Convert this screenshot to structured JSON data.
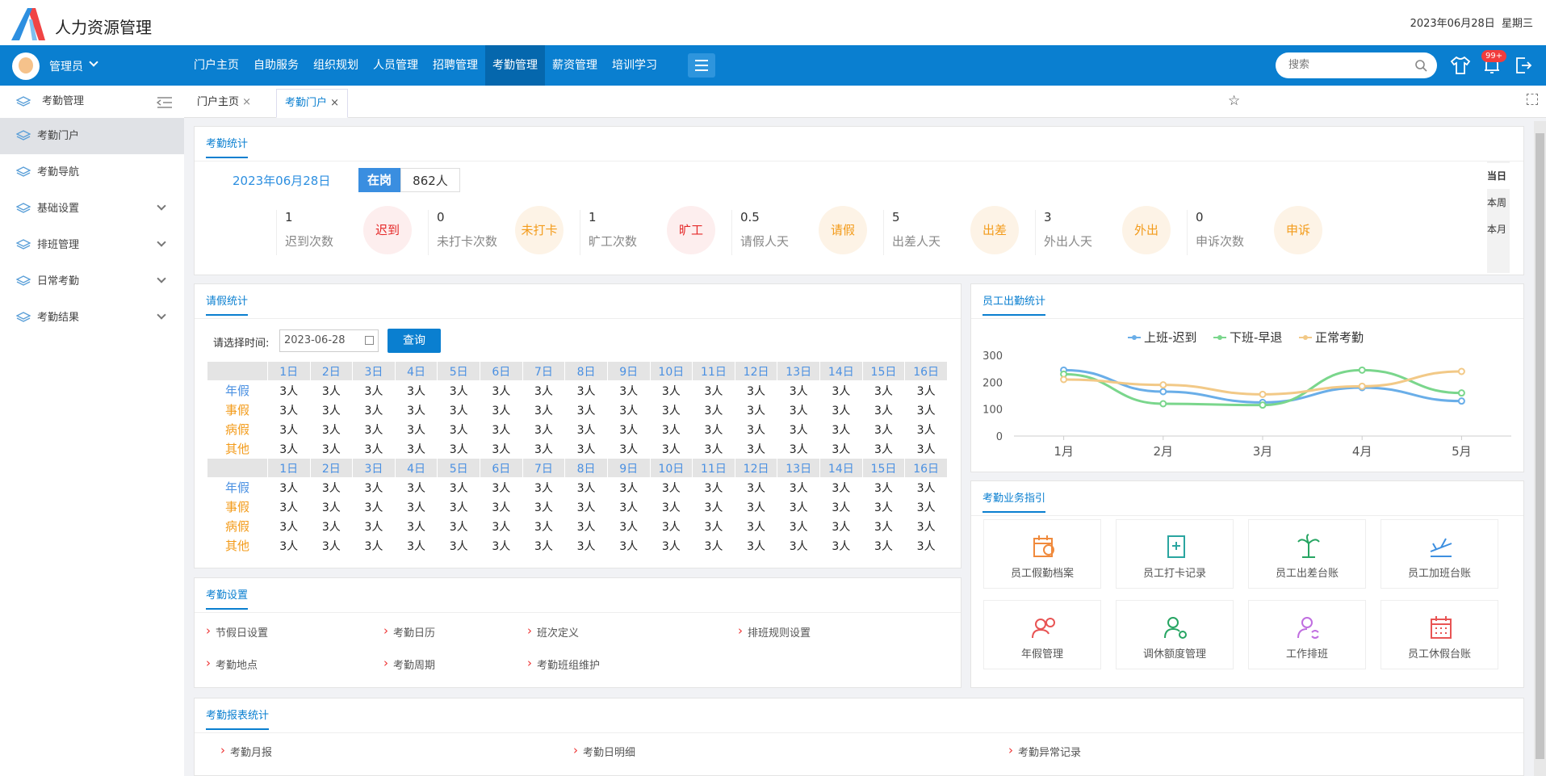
{
  "app": {
    "title": "人力资源管理",
    "date": "2023年06月28日  星期三"
  },
  "nav": {
    "user": "管理员",
    "items": [
      "门户主页",
      "自助服务",
      "组织规划",
      "人员管理",
      "招聘管理",
      "考勤管理",
      "薪资管理",
      "培训学习"
    ],
    "active": 5,
    "search_placeholder": "搜索",
    "badge": "99+"
  },
  "sidebar": {
    "header": "考勤管理",
    "items": [
      {
        "label": "考勤门户",
        "active": true
      },
      {
        "label": "考勤导航"
      },
      {
        "label": "基础设置",
        "expand": true
      },
      {
        "label": "排班管理",
        "expand": true
      },
      {
        "label": "日常考勤",
        "expand": true
      },
      {
        "label": "考勤结果",
        "expand": true
      }
    ]
  },
  "tabs": [
    {
      "label": "门户主页"
    },
    {
      "label": "考勤门户",
      "active": true
    }
  ],
  "stats": {
    "title": "考勤统计",
    "date": "2023年06月28日",
    "status_label": "在岗",
    "status_count": "862人",
    "items": [
      {
        "num": "1",
        "label": "迟到次数",
        "badge": "迟到",
        "color": "#e52929",
        "bg": "#fdeeee"
      },
      {
        "num": "0",
        "label": "未打卡次数",
        "badge": "未打卡",
        "color": "#f39b1a",
        "bg": "#fdf3e6"
      },
      {
        "num": "1",
        "label": "旷工次数",
        "badge": "旷工",
        "color": "#e52929",
        "bg": "#fdeeee"
      },
      {
        "num": "0.5",
        "label": "请假人天",
        "badge": "请假",
        "color": "#f39b1a",
        "bg": "#fdf3e6"
      },
      {
        "num": "5",
        "label": "出差人天",
        "badge": "出差",
        "color": "#f39b1a",
        "bg": "#fdf3e6"
      },
      {
        "num": "3",
        "label": "外出人天",
        "badge": "外出",
        "color": "#f39b1a",
        "bg": "#fdf3e6"
      },
      {
        "num": "0",
        "label": "申诉次数",
        "badge": "申诉",
        "color": "#f39b1a",
        "bg": "#fdf3e6"
      }
    ],
    "periods": [
      "当日",
      "本周",
      "本月"
    ]
  },
  "leave": {
    "title": "请假统计",
    "date_label": "请选择时间:",
    "date_value": "2023-06-28",
    "query": "查询",
    "days": [
      "1日",
      "2日",
      "3日",
      "4日",
      "5日",
      "6日",
      "7日",
      "8日",
      "9日",
      "10日",
      "11日",
      "12日",
      "13日",
      "14日",
      "15日",
      "16日"
    ],
    "rows": [
      {
        "label": "年假",
        "color": "#4a90e2"
      },
      {
        "label": "事假",
        "color": "#f39b1a"
      },
      {
        "label": "病假",
        "color": "#f39b1a"
      },
      {
        "label": "其他",
        "color": "#f39b1a"
      }
    ],
    "cell": "3人"
  },
  "settings": {
    "title": "考勤设置",
    "links": [
      "节假日设置",
      "考勤日历",
      "班次定义",
      "排班规则设置",
      "考勤地点",
      "考勤周期",
      "考勤班组维护"
    ]
  },
  "reports": {
    "title": "考勤报表统计",
    "links": [
      "考勤月报",
      "考勤日明细",
      "考勤异常记录"
    ]
  },
  "attendance_chart": {
    "title": "员工出勤统计"
  },
  "chart_data": {
    "type": "line",
    "categories": [
      "1月",
      "2月",
      "3月",
      "4月",
      "5月"
    ],
    "ylim": [
      0,
      300
    ],
    "yticks": [
      0,
      100,
      200,
      300
    ],
    "legend": "top",
    "series": [
      {
        "name": "上班-迟到",
        "color": "#6aaee8",
        "values": [
          245,
          165,
          125,
          180,
          130
        ]
      },
      {
        "name": "下班-早退",
        "color": "#7ad68c",
        "values": [
          230,
          120,
          115,
          245,
          160
        ]
      },
      {
        "name": "正常考勤",
        "color": "#f2c987",
        "values": [
          210,
          190,
          155,
          185,
          240
        ]
      }
    ]
  },
  "guide": {
    "title": "考勤业务指引",
    "items": [
      {
        "label": "员工假勤档案",
        "icon": "calendar-clock-icon",
        "color": "#f08a3c"
      },
      {
        "label": "员工打卡记录",
        "icon": "punch-card-icon",
        "color": "#2aa5a0"
      },
      {
        "label": "员工出差台账",
        "icon": "palm-tree-icon",
        "color": "#27a563"
      },
      {
        "label": "员工加班台账",
        "icon": "airplane-icon",
        "color": "#3d8fe0"
      },
      {
        "label": "年假管理",
        "icon": "user-clock-icon",
        "color": "#e85454"
      },
      {
        "label": "调休额度管理",
        "icon": "user-gear-icon",
        "color": "#27a563"
      },
      {
        "label": "工作排班",
        "icon": "user-sync-icon",
        "color": "#c06ee0"
      },
      {
        "label": "员工休假台账",
        "icon": "calendar-grid-icon",
        "color": "#e85454"
      }
    ]
  }
}
